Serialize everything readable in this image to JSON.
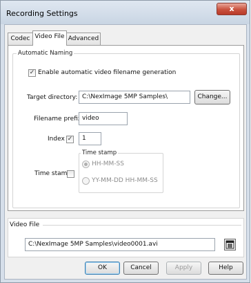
{
  "window": {
    "title": "Recording Settings",
    "close_label": "x"
  },
  "tabs": [
    {
      "label": "Codec"
    },
    {
      "label": "Video File"
    },
    {
      "label": "Advanced"
    }
  ],
  "automatic_naming": {
    "legend": "Automatic Naming",
    "enable_label": "Enable automatic video filename generation",
    "enable_checked": true,
    "target_directory_label": "Target directory:",
    "target_directory_value": "C:\\NexImage 5MP Samples\\",
    "change_button": "Change...",
    "filename_prefix_label": "Filename prefix:",
    "filename_prefix_value": "video",
    "index_label": "Index",
    "index_checked": true,
    "index_value": "1",
    "time_stamp_label": "Time stamp",
    "time_stamp_checked": false,
    "time_stamp_group_legend": "Time stamp",
    "time_stamp_options": [
      "HH-MM-SS",
      "YY-MM-DD HH-MM-SS"
    ],
    "time_stamp_selected": "HH-MM-SS"
  },
  "video_file": {
    "legend": "Video File",
    "path_value": "C:\\NexImage 5MP Samples\\video0001.avi"
  },
  "footer": {
    "ok": "OK",
    "cancel": "Cancel",
    "apply": "Apply",
    "help": "Help"
  }
}
